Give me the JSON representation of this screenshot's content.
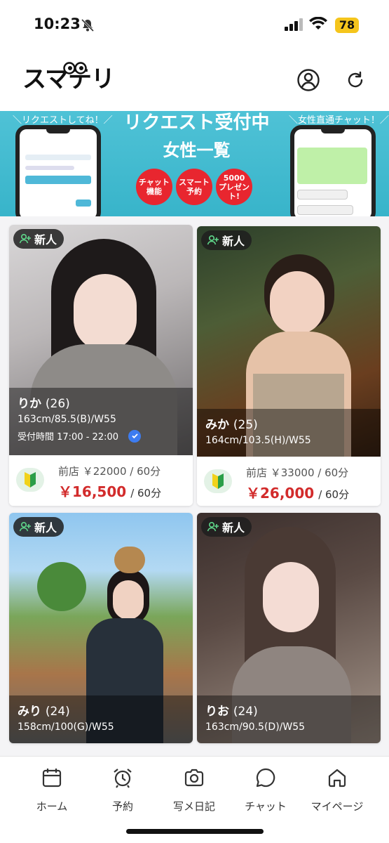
{
  "status": {
    "time": "10:23",
    "battery": "78"
  },
  "header": {
    "logo": "スマテリ"
  },
  "banner": {
    "left_tag": "＼リクエストしてね！／",
    "right_tag": "＼女性直通チャット！／",
    "title": "リクエスト受付中",
    "subtitle": "女性一覧",
    "pills": [
      "チャット\n機能",
      "スマート\n予約",
      "5000\nプレゼント!"
    ]
  },
  "cards": [
    {
      "badge": "新人",
      "name": "りか",
      "age": "(26)",
      "size": "163cm/85.5(B)/W55",
      "hours": "受付時間 17:00 - 22:00",
      "prev_price": "前店 ￥22000 / 60分",
      "price": "￥16,500",
      "per": "/ 60分"
    },
    {
      "badge": "新人",
      "name": "みか",
      "age": "(25)",
      "size": "164cm/103.5(H)/W55",
      "prev_price": "前店 ￥33000 / 60分",
      "price": "￥26,000",
      "per": "/ 60分"
    },
    {
      "badge": "新人",
      "name": "みり",
      "age": "(24)",
      "size": "158cm/100(G)/W55"
    },
    {
      "badge": "新人",
      "name": "りお",
      "age": "(24)",
      "size": "163cm/90.5(D)/W55"
    }
  ],
  "tabs": [
    "ホーム",
    "予約",
    "写メ日記",
    "チャット",
    "マイページ"
  ]
}
